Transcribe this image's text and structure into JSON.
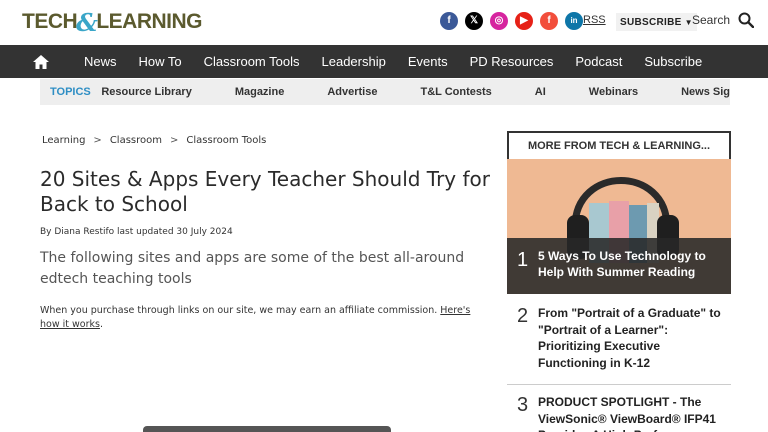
{
  "brand": {
    "name_part1": "TECH",
    "amp": "&",
    "name_part2": "LEARNING"
  },
  "header": {
    "social": [
      {
        "icon": "facebook-icon",
        "glyph": "f"
      },
      {
        "icon": "x-icon",
        "glyph": "𝕏"
      },
      {
        "icon": "instagram-icon",
        "glyph": "◎"
      },
      {
        "icon": "youtube-icon",
        "glyph": "▶"
      },
      {
        "icon": "flipboard-icon",
        "glyph": "f"
      },
      {
        "icon": "linkedin-icon",
        "glyph": "in"
      }
    ],
    "rss_label": "RSS",
    "subscribe_label": "SUBSCRIBE",
    "search_label": "Search"
  },
  "nav": {
    "items": [
      "News",
      "How To",
      "Classroom Tools",
      "Leadership",
      "Events",
      "PD Resources",
      "Podcast",
      "Subscribe"
    ]
  },
  "topics": {
    "label": "TOPICS",
    "items": [
      "Resource Library",
      "Magazine",
      "Advertise",
      "T&L Contests",
      "AI",
      "Webinars",
      "News Sig"
    ]
  },
  "article": {
    "breadcrumb": [
      "Learning",
      "Classroom",
      "Classroom Tools"
    ],
    "breadcrumb_sep": ">",
    "title": "20 Sites & Apps Every Teacher Should Try for Back to School",
    "byline": "By Diana Restifo last updated 30 July 2024",
    "standfirst": "The following sites and apps are some of the best all-around edtech teaching tools",
    "affiliate_text": "When you purchase through links on our site, we may earn an affiliate commission. ",
    "affiliate_link": "Here's how it works",
    "affiliate_end": "."
  },
  "sidebar": {
    "heading": "MORE FROM TECH & LEARNING...",
    "items": [
      {
        "rank": "1",
        "title": "5 Ways To Use Technology to Help With Summer Reading"
      },
      {
        "rank": "2",
        "title": "From \"Portrait of a Graduate\" to \"Portrait of a Learner\": Prioritizing Executive Functioning in K-12"
      },
      {
        "rank": "3",
        "title": "PRODUCT SPOTLIGHT - The ViewSonic® ViewBoard® IFP41 Provides A High-Perf"
      }
    ]
  },
  "colors": {
    "nav_bg": "#333333",
    "topics_accent": "#2e8ec4",
    "logo_text": "#5b5a2e",
    "logo_amp": "#3aa6c8"
  }
}
